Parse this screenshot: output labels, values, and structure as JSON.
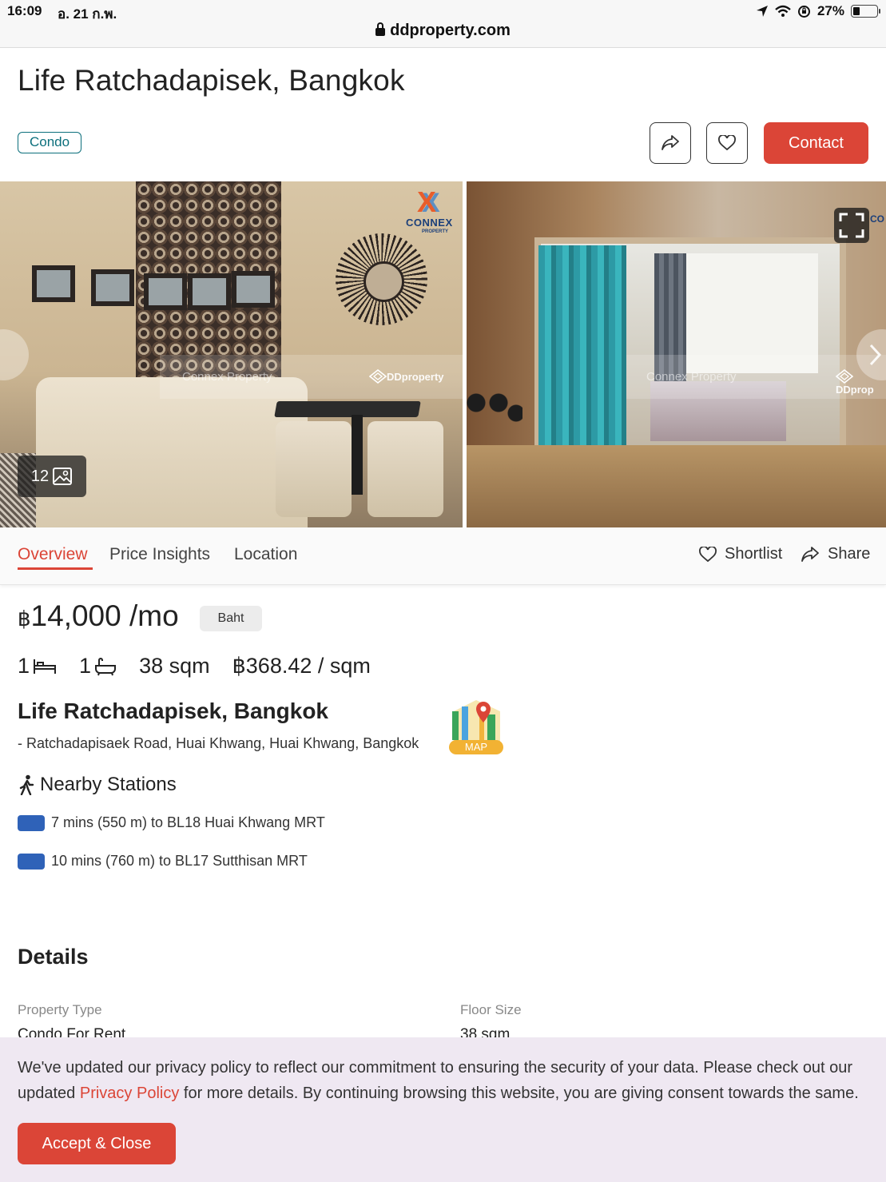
{
  "status_bar": {
    "time": "16:09",
    "date": "อ. 21 ก.พ.",
    "battery_percent": "27%",
    "battery_level": 0.27,
    "url": "ddproperty.com"
  },
  "header": {
    "title": "Life Ratchadapisek, Bangkok",
    "property_tag": "Condo",
    "contact_label": "Contact"
  },
  "gallery": {
    "photo_count": "12",
    "watermark_left": "Connex Property",
    "watermark_left_2": "Connex Property",
    "watermark_brand": "DDproperty",
    "watermark_brand_2": "DDprop",
    "logo_text": "CONNEX",
    "logo_subtext": "PROPERTY",
    "logo_text_2": "CO"
  },
  "tabs": {
    "items": [
      {
        "label": "Overview"
      },
      {
        "label": "Price Insights"
      },
      {
        "label": "Location"
      }
    ],
    "active": "Overview",
    "shortlist_label": "Shortlist",
    "share_label": "Share"
  },
  "listing": {
    "currency_symbol": "฿",
    "price": "14,000 /mo",
    "currency_badge": "Baht",
    "bedrooms": "1",
    "bathrooms": "1",
    "floor_area": "38 sqm",
    "price_per_sqm": "฿368.42 / sqm",
    "title": "Life Ratchadapisek, Bangkok",
    "address": "- Ratchadapisaek Road, Huai Khwang, Huai Khwang, Bangkok",
    "map_label": "MAP"
  },
  "nearby": {
    "title": "Nearby Stations",
    "stations": [
      {
        "text": "7 mins (550 m) to BL18 Huai Khwang MRT",
        "color": "#2f62b8"
      },
      {
        "text": "10 mins (760 m) to BL17 Sutthisan MRT",
        "color": "#2f62b8"
      }
    ]
  },
  "details": {
    "title": "Details",
    "fields": [
      {
        "label": "Property Type",
        "value": "Condo For Rent"
      },
      {
        "label": "Floor Size",
        "value": "38 sqm"
      }
    ]
  },
  "privacy": {
    "text_before": "We've updated our privacy policy to reflect our commitment to ensuring the security of your data. Please check out our updated ",
    "link_text": "Privacy Policy",
    "text_after": " for more details. By continuing browsing this website, you are giving consent towards the same.",
    "accept_label": "Accept & Close"
  },
  "colors": {
    "accent": "#db4537",
    "tag": "#0c6f7c",
    "mrt_blue": "#2f62b8"
  },
  "icons": [
    "lock-icon",
    "location-arrow-icon",
    "wifi-icon",
    "rotation-lock-icon",
    "battery-icon",
    "share-icon",
    "heart-icon",
    "expand-icon",
    "gallery-icon",
    "bed-icon",
    "bath-icon",
    "map-icon",
    "walking-icon"
  ]
}
